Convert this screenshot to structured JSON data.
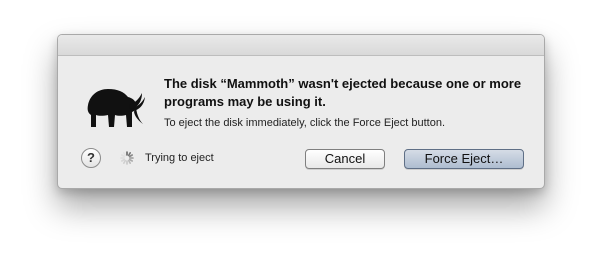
{
  "dialog": {
    "message": "The disk “Mammoth” wasn't ejected because one or more programs may be using it.",
    "informative_text": "To eject the disk immediately, click the Force Eject button.",
    "status_text": "Trying to eject",
    "help_label": "?",
    "cancel_label": "Cancel",
    "force_eject_label": "Force Eject…"
  },
  "icons": {
    "app": "mammoth-icon",
    "help": "help-icon",
    "spinner": "spinner-icon"
  }
}
